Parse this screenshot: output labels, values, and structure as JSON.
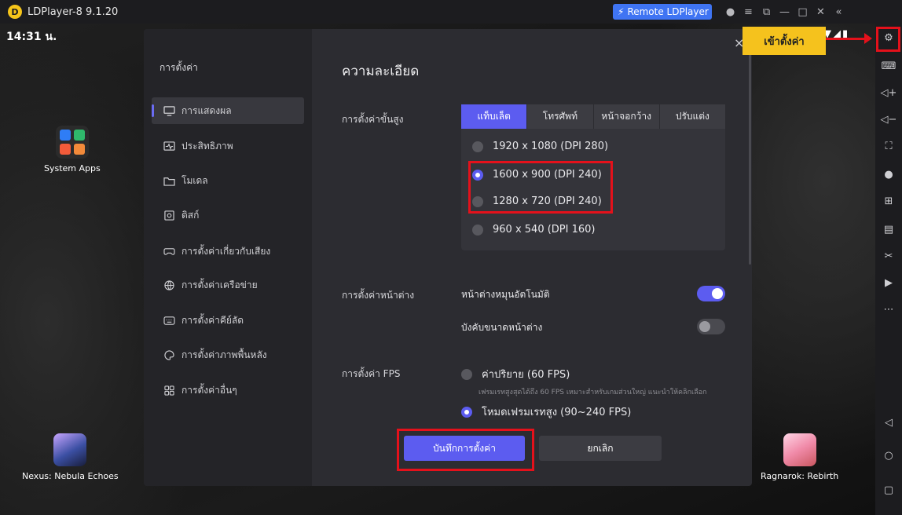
{
  "window": {
    "title": "LDPlayer-8 9.1.20",
    "remote_label": "Remote LDPlayer",
    "icons": [
      "account-icon",
      "menu-icon",
      "restore-icon",
      "minimize-icon",
      "maximize-icon",
      "close-icon",
      "collapse-icon"
    ]
  },
  "status_bar": {
    "time": "14:31 น.",
    "indicators": "▼◢▮"
  },
  "desktop": {
    "apps": [
      {
        "label": "System Apps"
      },
      {
        "label": "Nexus: Nebula Echoes"
      },
      {
        "label": "Ragnarok: Rebirth"
      }
    ]
  },
  "right_sidebar": {
    "items": [
      "settings-icon",
      "keyboard-icon",
      "volume-up-icon",
      "volume-down-icon",
      "fullscreen-icon",
      "location-icon",
      "add-app-icon",
      "apk-icon",
      "scissors-icon",
      "record-icon",
      "more-icon",
      "back-icon",
      "home-icon",
      "recents-icon"
    ]
  },
  "settings": {
    "sidebar_title": "การตั้งค่า",
    "nav": [
      {
        "label": "การแสดงผล",
        "icon": "monitor-icon",
        "active": true
      },
      {
        "label": "ประสิทธิภาพ",
        "icon": "performance-icon",
        "active": false
      },
      {
        "label": "โมเดล",
        "icon": "folder-icon",
        "active": false
      },
      {
        "label": "ดิสก์",
        "icon": "disk-icon",
        "active": false
      },
      {
        "label": "การตั้งค่าเกี่ยวกับเสียง",
        "icon": "gamepad-icon",
        "active": false
      },
      {
        "label": "การตั้งค่าเครือข่าย",
        "icon": "globe-icon",
        "active": false
      },
      {
        "label": "การตั้งค่าคีย์ลัด",
        "icon": "keyboard-icon",
        "active": false
      },
      {
        "label": "การตั้งค่าภาพพื้นหลัง",
        "icon": "palette-icon",
        "active": false
      },
      {
        "label": "การตั้งค่าอื่นๆ",
        "icon": "grid-icon",
        "active": false
      }
    ],
    "section_title": "ความละเอียด",
    "advanced_label": "การตั้งค่าขั้นสูง",
    "tabs": [
      {
        "label": "แท็บเล็ต",
        "active": true
      },
      {
        "label": "โทรศัพท์",
        "active": false
      },
      {
        "label": "หน้าจอกว้าง",
        "active": false
      },
      {
        "label": "ปรับแต่ง",
        "active": false
      }
    ],
    "resolutions": [
      {
        "label": "1920 x 1080  (DPI 280)",
        "selected": false
      },
      {
        "label": "1600 x 900  (DPI 240)",
        "selected": true
      },
      {
        "label": "1280 x 720  (DPI 240)",
        "selected": false
      },
      {
        "label": "960 x 540  (DPI 160)",
        "selected": false
      }
    ],
    "window_label": "การตั้งค่าหน้าต่าง",
    "auto_rotate": {
      "label": "หน้าต่างหมุนอัตโนมัติ",
      "on": true
    },
    "force_size": {
      "label": "บังคับขนาดหน้าต่าง",
      "on": false
    },
    "fps_label": "การตั้งค่า FPS",
    "fps_default": {
      "label": "ค่าปริยาย (60 FPS)",
      "desc": "เฟรมเรทสูงสุดได้ถึง 60 FPS เหมาะสำหรับเกมส่วนใหญ่ แนะนำให้คลิกเลือก",
      "selected": false
    },
    "fps_high": {
      "label": "โหมดเฟรมเรทสูง (90~240 FPS)",
      "selected": true
    },
    "save_label": "บันทึกการตั้งค่า",
    "cancel_label": "ยกเลิก"
  },
  "annotation": {
    "callout_text": "เข้าตั้งค่า"
  },
  "colors": {
    "accent": "#5c5cf0",
    "highlight": "#e4111b",
    "callout": "#f5c21d"
  }
}
